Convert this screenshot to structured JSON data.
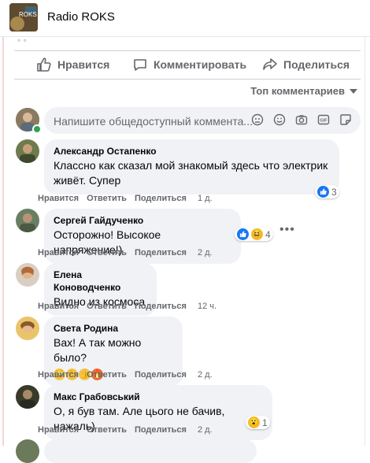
{
  "header": {
    "title": "Radio ROKS",
    "logo_text": "ROKS"
  },
  "post_actions": {
    "like": "Нравится",
    "comment": "Комментировать",
    "share": "Поделиться"
  },
  "sort": {
    "label": "Топ комментариев"
  },
  "composer": {
    "placeholder": "Напишите общедоступный коммента..."
  },
  "comments": [
    {
      "author": "Александр Остапенко",
      "text": "Классно как сказал мой знакомый здесь что электрик живёт. Супер",
      "like": "Нравится",
      "reply": "Ответить",
      "share": "Поделиться",
      "time": "1 д.",
      "reactions": "3"
    },
    {
      "author": "Сергей Гайдученко",
      "text": "Осторожно! Высокое напряжение!)",
      "like": "Нравится",
      "reply": "Ответить",
      "share": "Поделиться",
      "time": "2 д.",
      "reactions": "4"
    },
    {
      "author": "Елена Коноводченко",
      "text": "Видно из космоса",
      "like": "Нравится",
      "reply": "Ответить",
      "share": "Поделиться",
      "time": "12 ч.",
      "reactions": ""
    },
    {
      "author": "Света Родина",
      "text": "Вах! А так можно было?",
      "like": "Нравится",
      "reply": "Ответить",
      "share": "Поделиться",
      "time": "2 д.",
      "reactions": ""
    },
    {
      "author": "Макс Грабовський",
      "text": "О, я був там. Але цього не бачив, нажаль)",
      "like": "Нравится",
      "reply": "Ответить",
      "share": "Поделиться",
      "time": "2 д.",
      "reactions": "1"
    }
  ],
  "colors": {
    "accent": "#1877f2",
    "bubble": "#f0f2f5",
    "meta": "#65676b"
  }
}
